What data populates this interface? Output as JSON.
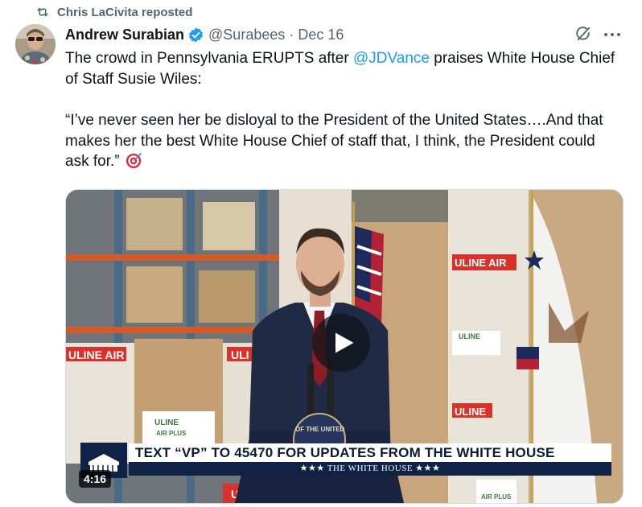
{
  "repost": {
    "label": "Chris LaCivita reposted",
    "icon": "repost-icon"
  },
  "author": {
    "name": "Andrew Surabian",
    "handle": "@Surabees",
    "separator": "·",
    "date": "Dec 16"
  },
  "tweet": {
    "line1_before": "The crowd in Pennsylvania ERUPTS after ",
    "mention": "@JDVance",
    "line1_after": " praises White House Chief of Staff Susie Wiles:",
    "quote": "“I’ve never seen her be disloyal to the President of the United States….And that makes her the best White House Chief of staff that, I think, the President could ask for.”",
    "emoji": "direct-hit-icon"
  },
  "video": {
    "duration": "4:16",
    "lower_third_headline": "TEXT “VP” TO 45470 FOR UPDATES FROM THE WHITE HOUSE",
    "lower_third_sub": "★★★  THE WHITE HOUSE  ★★★",
    "box_labels": [
      "ULINE AIR",
      "ULINE AIR",
      "ULINE",
      "ULINE",
      "ULINE",
      "ULINE",
      "ULI",
      "AIR PLUS",
      "AIR PLUS"
    ],
    "podium_text": "OF THE UNITED"
  },
  "colors": {
    "link": "#1d9bf0",
    "verified": "#1d9bf0",
    "muted": "#536471",
    "uline_red": "#d8322b"
  }
}
